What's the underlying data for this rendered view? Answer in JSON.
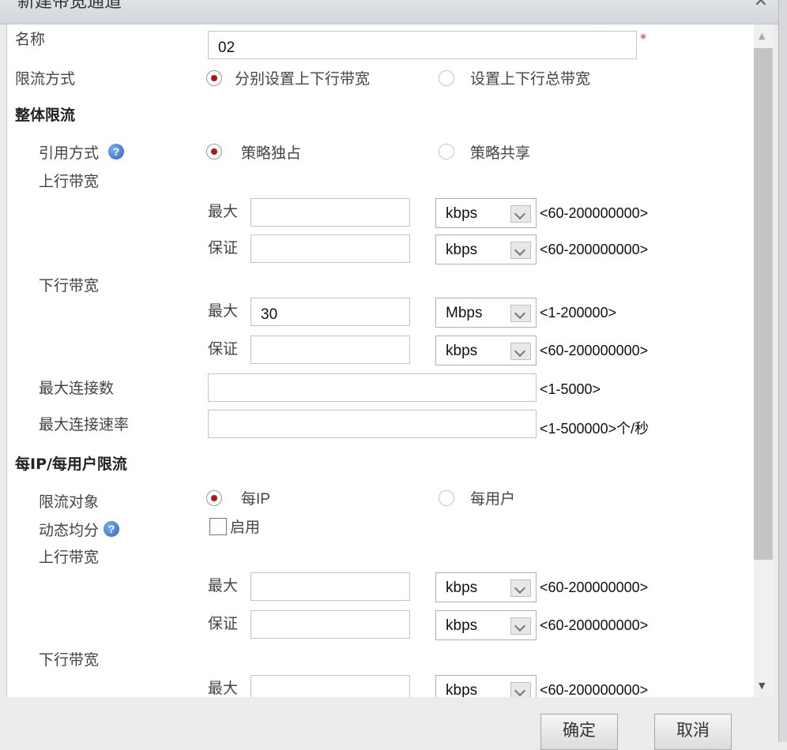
{
  "dialog": {
    "title": "新建带宽通道",
    "close_glyph": "×"
  },
  "form": {
    "name_label": "名称",
    "name_value": "02",
    "required_mark": "*",
    "limit_mode_label": "限流方式",
    "limit_mode_options": [
      "分别设置上下行带宽",
      "设置上下行总带宽"
    ],
    "limit_mode_selected": "分别设置上下行带宽"
  },
  "overall": {
    "title": "整体限流",
    "ref_mode_label": "引用方式",
    "ref_mode_options": [
      "策略独占",
      "策略共享"
    ],
    "ref_mode_selected": "策略独占",
    "help_glyph": "?",
    "up_label": "上行带宽",
    "up_max_label": "最大",
    "up_max_value": "",
    "up_max_unit": "kbps",
    "up_max_range": "<60-200000000>",
    "up_guar_label": "保证",
    "up_guar_value": "",
    "up_guar_unit": "kbps",
    "up_guar_range": "<60-200000000>",
    "down_label": "下行带宽",
    "down_max_label": "最大",
    "down_max_value": "30",
    "down_max_unit": "Mbps",
    "down_max_range": "<1-200000>",
    "down_guar_label": "保证",
    "down_guar_value": "",
    "down_guar_unit": "kbps",
    "down_guar_range": "<60-200000000>",
    "max_conn_label": "最大连接数",
    "max_conn_value": "",
    "max_conn_range": "<1-5000>",
    "max_conn_rate_label": "最大连接速率",
    "max_conn_rate_value": "",
    "max_conn_rate_range": "<1-500000>个/秒"
  },
  "perip": {
    "title": "每IP/每用户限流",
    "target_label": "限流对象",
    "target_options": [
      "每IP",
      "每用户"
    ],
    "target_selected": "每IP",
    "dynamic_label": "动态均分",
    "help_glyph": "?",
    "enable_label": "启用",
    "enable_checked": false,
    "up_label": "上行带宽",
    "up_max_label": "最大",
    "up_max_value": "",
    "up_max_unit": "kbps",
    "up_max_range": "<60-200000000>",
    "up_guar_label": "保证",
    "up_guar_value": "",
    "up_guar_unit": "kbps",
    "up_guar_range": "<60-200000000>",
    "down_label": "下行带宽",
    "down_max_label": "最大",
    "down_max_value": "",
    "down_max_unit": "kbps",
    "down_max_range": "<60-200000000>"
  },
  "scrollbar": {
    "up_glyph": "▲",
    "down_glyph": "▼"
  },
  "buttons": {
    "ok": "确定",
    "cancel": "取消"
  }
}
